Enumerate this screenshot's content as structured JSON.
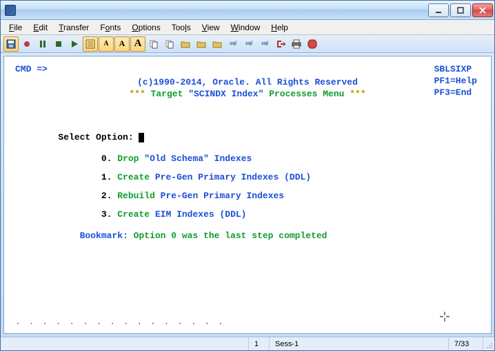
{
  "window": {
    "title": ""
  },
  "menu": {
    "file": "File",
    "edit": "Edit",
    "transfer": "Transfer",
    "fonts": "Fonts",
    "options": "Options",
    "tools": "Tools",
    "view": "View",
    "window": "Window",
    "help": "Help"
  },
  "toolbar_icons": {
    "floppy": "floppy-icon",
    "record": "record-icon",
    "pause": "pause-icon",
    "stop": "stop-icon",
    "play": "play-icon",
    "settings": "settings-icon",
    "font_a1": "A",
    "font_a2": "A",
    "font_a3": "A",
    "copy1": "copy-icon",
    "copy2": "copy-icon",
    "open1": "open-icon",
    "open2": "open-icon",
    "open3": "open-icon",
    "sql1": "sql",
    "sql2": "sql",
    "sql3": "sql",
    "exit": "exit-icon",
    "print": "print-icon",
    "stop2": "stop-icon"
  },
  "terminal": {
    "cmd": "CMD =>",
    "copyright": "(c)1990-2014, Oracle. All Rights Reserved",
    "stars": "***",
    "target_pre": "Target ",
    "target_quoted": "\"SCINDX Index\"",
    "target_post": " Processes Menu ",
    "program": "SBLSIXP",
    "pf1": "PF1=Help",
    "pf3": "PF3=End",
    "select": "Select Option: ",
    "opt0_n": "0.",
    "opt0_a": "Drop ",
    "opt0_b": "\"Old Schema\" Indexes",
    "opt1_n": "1.",
    "opt1_a": "Create ",
    "opt1_b": "Pre-Gen Primary Indexes (DDL)",
    "opt2_n": "2.",
    "opt2_a": "Rebuild ",
    "opt2_b": "Pre-Gen Primary Indexes",
    "opt3_n": "3.",
    "opt3_a": "Create ",
    "opt3_b": "EIM Indexes (DDL)",
    "bookmark_label": "Bookmark: ",
    "bookmark_text": "Option 0 was the last step completed",
    "dots": ".    .    .    .    .    .    .    .    .    .    .    .    .    .    .    ."
  },
  "status": {
    "num": "1",
    "sess": "Sess-1",
    "pos": "7/33"
  }
}
